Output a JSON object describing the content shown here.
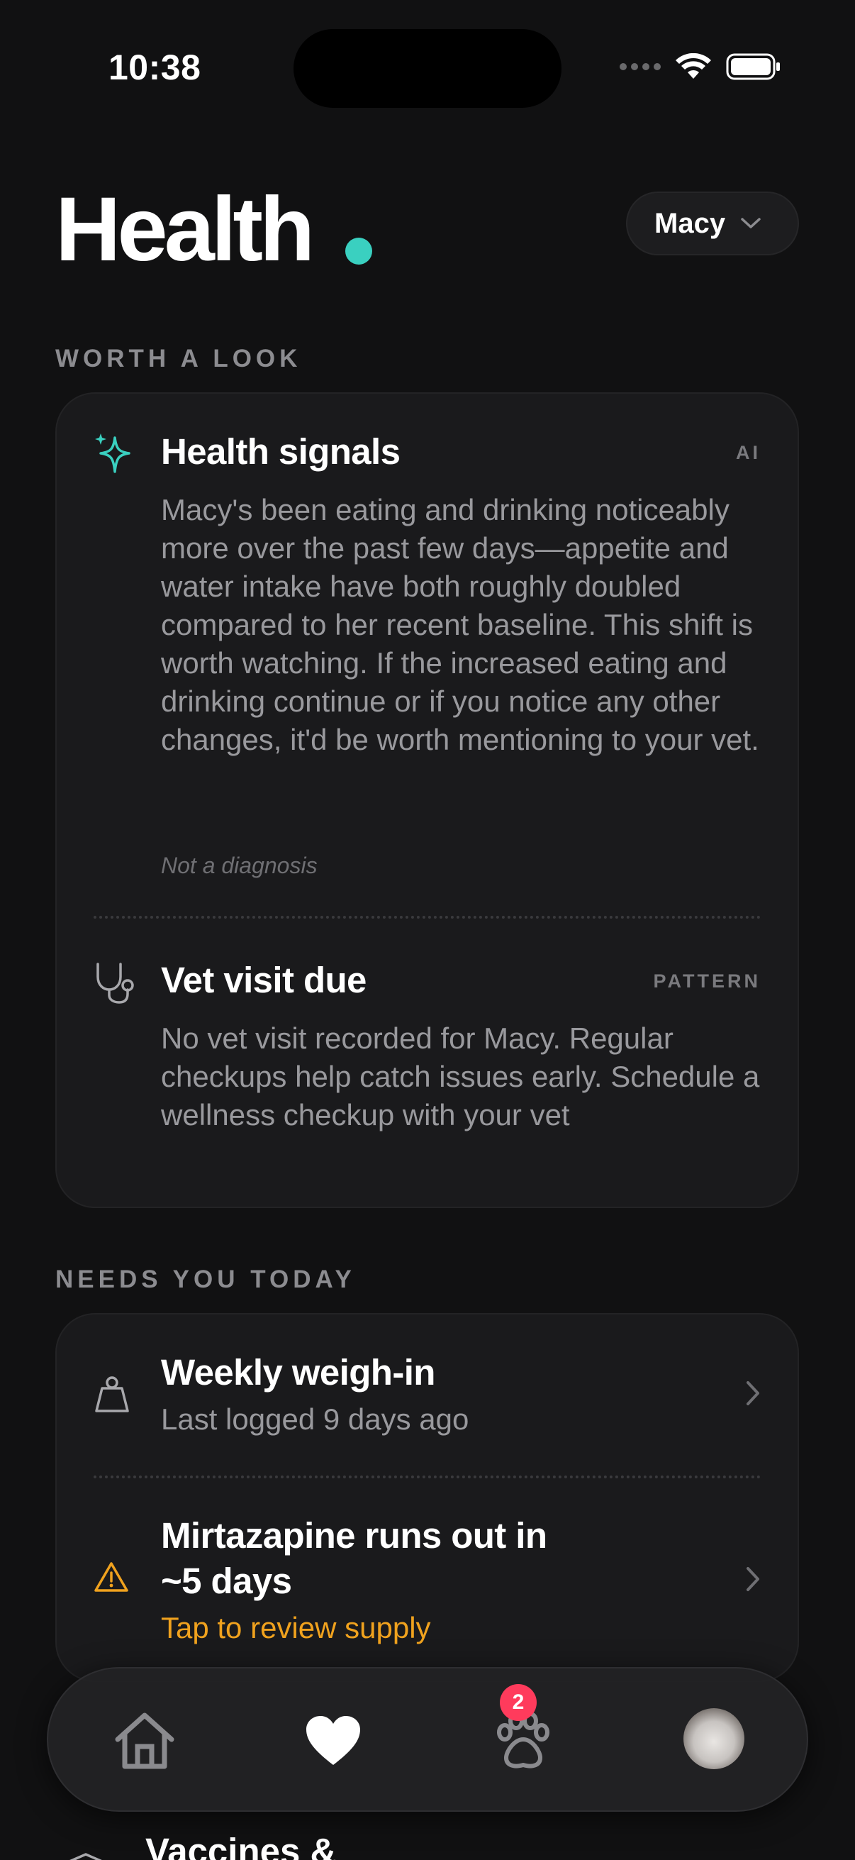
{
  "status_bar": {
    "time": "10:38"
  },
  "header": {
    "title": "Health",
    "pet_selector": "Macy"
  },
  "worth_a_look": {
    "label": "WORTH A LOOK",
    "items": [
      {
        "title": "Health signals",
        "tag": "AI",
        "icon": "sparkles-icon",
        "body": "Macy's been eating and drinking noticeably more over the past few days—appetite and water intake have both roughly doubled compared to her recent baseline. This shift is worth watching. If the increased eating and drinking continue or if you notice any other changes, it'd be worth mentioning to your vet.",
        "note": "Not a diagnosis"
      },
      {
        "title": "Vet visit due",
        "tag": "PATTERN",
        "icon": "stethoscope-icon",
        "body": "No vet visit recorded for Macy. Regular checkups help catch issues early. Schedule a wellness checkup with your vet"
      }
    ]
  },
  "needs_you_today": {
    "label": "NEEDS YOU TODAY",
    "items": [
      {
        "title": "Weekly weigh-in",
        "subtitle": "Last logged 9 days ago",
        "icon": "scale-icon"
      },
      {
        "title_line1": "Mirtazapine runs out in",
        "title_line2": "~5 days",
        "subtitle": "Tap to review supply",
        "icon": "warning-icon"
      }
    ]
  },
  "peek": {
    "title": "Vaccines &"
  },
  "tab_bar": {
    "tabs": [
      "home-icon",
      "heart-icon",
      "paw-icon",
      "avatar"
    ],
    "active": "heart-icon",
    "paw_badge": "2"
  },
  "colors": {
    "accent": "#3ad0c0",
    "warning": "#f0a21e",
    "badge": "#ff3b5c",
    "background": "#111112",
    "card": "#1a1a1c"
  }
}
